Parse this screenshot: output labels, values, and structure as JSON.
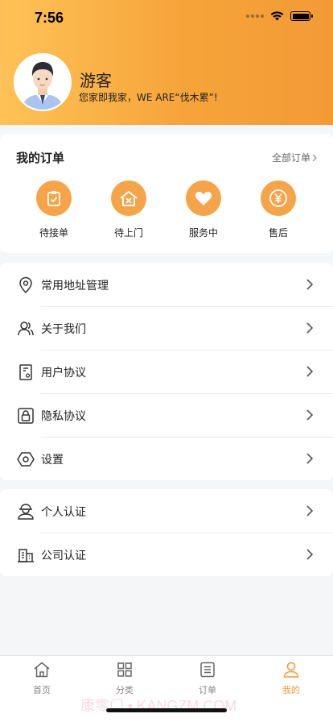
{
  "status_bar": {
    "time": "7:56"
  },
  "profile": {
    "name": "游客",
    "slogan": "您家即我家，WE ARE“伐木累”!"
  },
  "orders": {
    "title": "我的订单",
    "all_link": "全部订单",
    "items": [
      {
        "label": "待接单",
        "icon": "clipboard-check-icon"
      },
      {
        "label": "待上门",
        "icon": "house-tools-icon"
      },
      {
        "label": "服务中",
        "icon": "heart-icon"
      },
      {
        "label": "售后",
        "icon": "yen-coin-icon"
      }
    ]
  },
  "menu_main": [
    {
      "label": "常用地址管理",
      "icon": "location-pin-icon"
    },
    {
      "label": "关于我们",
      "icon": "users-icon"
    },
    {
      "label": "用户协议",
      "icon": "document-icon"
    },
    {
      "label": "隐私协议",
      "icon": "lock-icon"
    },
    {
      "label": "设置",
      "icon": "hexagon-settings-icon"
    }
  ],
  "menu_auth": [
    {
      "label": "个人认证",
      "icon": "person-badge-icon"
    },
    {
      "label": "公司认证",
      "icon": "building-icon"
    }
  ],
  "tabbar": [
    {
      "label": "首页",
      "icon": "home-icon",
      "active": false
    },
    {
      "label": "分类",
      "icon": "grid-icon",
      "active": false
    },
    {
      "label": "订单",
      "icon": "list-icon",
      "active": false
    },
    {
      "label": "我的",
      "icon": "person-icon",
      "active": true
    }
  ],
  "colors": {
    "accent": "#f39a36",
    "order_icon_bg": "#f5a449"
  },
  "watermark": "康零门 • KANGZM.COM"
}
